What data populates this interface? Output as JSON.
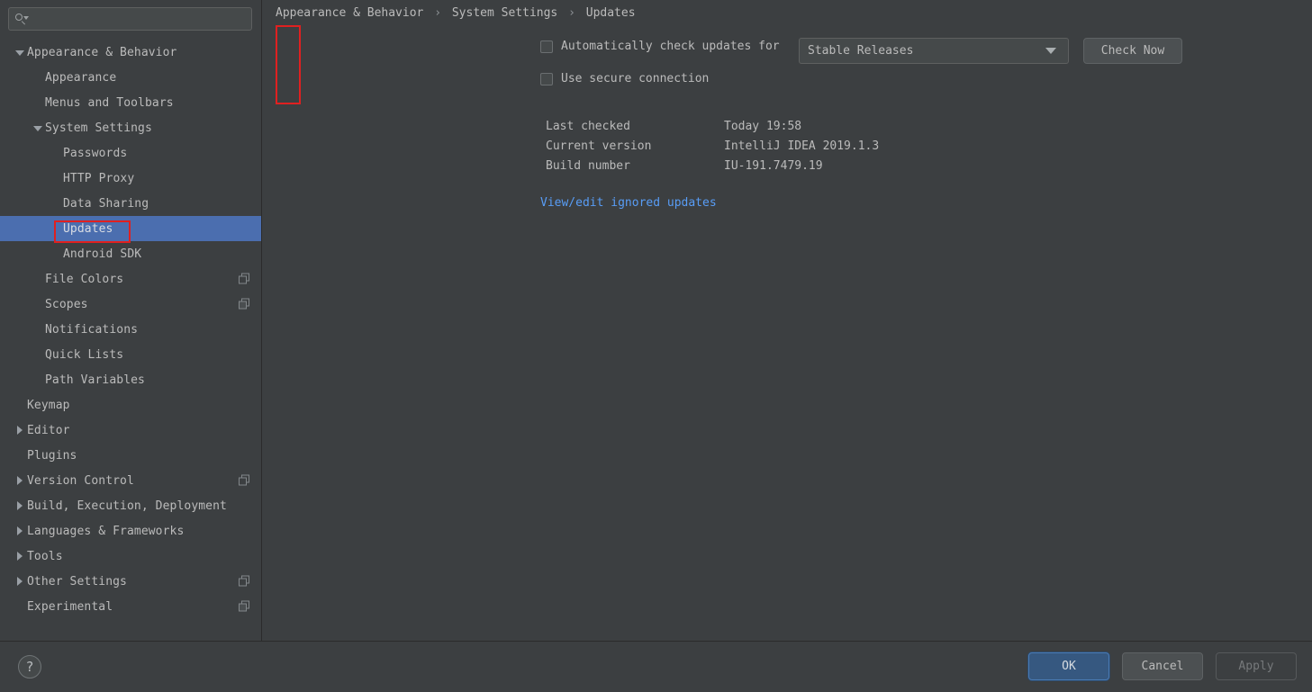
{
  "search": {
    "placeholder": "",
    "value": "",
    "icon": "search-icon"
  },
  "sidebar": {
    "items": [
      {
        "label": "Appearance & Behavior",
        "level": 0,
        "twisty": "down",
        "selected": false,
        "copy_icon": "none"
      },
      {
        "label": "Appearance",
        "level": 1,
        "twisty": "none",
        "selected": false,
        "copy_icon": "none"
      },
      {
        "label": "Menus and Toolbars",
        "level": 1,
        "twisty": "none",
        "selected": false,
        "copy_icon": "none"
      },
      {
        "label": "System Settings",
        "level": 1,
        "twisty": "down",
        "selected": false,
        "copy_icon": "none"
      },
      {
        "label": "Passwords",
        "level": 2,
        "twisty": "none",
        "selected": false,
        "copy_icon": "none"
      },
      {
        "label": "HTTP Proxy",
        "level": 2,
        "twisty": "none",
        "selected": false,
        "copy_icon": "none"
      },
      {
        "label": "Data Sharing",
        "level": 2,
        "twisty": "none",
        "selected": false,
        "copy_icon": "none"
      },
      {
        "label": "Updates",
        "level": 2,
        "twisty": "none",
        "selected": true,
        "copy_icon": "none"
      },
      {
        "label": "Android SDK",
        "level": 2,
        "twisty": "none",
        "selected": false,
        "copy_icon": "none"
      },
      {
        "label": "File Colors",
        "level": 1,
        "twisty": "none",
        "selected": false,
        "copy_icon": "copy-icon"
      },
      {
        "label": "Scopes",
        "level": 1,
        "twisty": "none",
        "selected": false,
        "copy_icon": "copy-icon-filled"
      },
      {
        "label": "Notifications",
        "level": 1,
        "twisty": "none",
        "selected": false,
        "copy_icon": "none"
      },
      {
        "label": "Quick Lists",
        "level": 1,
        "twisty": "none",
        "selected": false,
        "copy_icon": "none"
      },
      {
        "label": "Path Variables",
        "level": 1,
        "twisty": "none",
        "selected": false,
        "copy_icon": "none"
      },
      {
        "label": "Keymap",
        "level": 0,
        "twisty": "none",
        "selected": false,
        "copy_icon": "none"
      },
      {
        "label": "Editor",
        "level": 0,
        "twisty": "right",
        "selected": false,
        "copy_icon": "none"
      },
      {
        "label": "Plugins",
        "level": 0,
        "twisty": "none",
        "selected": false,
        "copy_icon": "none"
      },
      {
        "label": "Version Control",
        "level": 0,
        "twisty": "right",
        "selected": false,
        "copy_icon": "copy-icon"
      },
      {
        "label": "Build, Execution, Deployment",
        "level": 0,
        "twisty": "right",
        "selected": false,
        "copy_icon": "none"
      },
      {
        "label": "Languages & Frameworks",
        "level": 0,
        "twisty": "right",
        "selected": false,
        "copy_icon": "none"
      },
      {
        "label": "Tools",
        "level": 0,
        "twisty": "right",
        "selected": false,
        "copy_icon": "none"
      },
      {
        "label": "Other Settings",
        "level": 0,
        "twisty": "right",
        "selected": false,
        "copy_icon": "copy-icon"
      },
      {
        "label": "Experimental",
        "level": 0,
        "twisty": "none",
        "selected": false,
        "copy_icon": "copy-icon-filled"
      }
    ]
  },
  "breadcrumb": {
    "crumb1": "Appearance & Behavior",
    "sep1": "›",
    "crumb2": "System Settings",
    "sep2": "›",
    "crumb3": "Updates"
  },
  "main": {
    "auto_check_label": "Automatically check updates for",
    "auto_check_checked": false,
    "secure_connection_label": "Use secure connection",
    "secure_connection_checked": false,
    "channel_value": "Stable Releases",
    "check_now_label": "Check Now",
    "info_rows": [
      {
        "key": "Last checked",
        "value": "Today 19:58"
      },
      {
        "key": "Current version",
        "value": "IntelliJ IDEA 2019.1.3"
      },
      {
        "key": "Build number",
        "value": "IU-191.7479.19"
      }
    ],
    "ignored_updates_link": "View/edit ignored updates"
  },
  "footer": {
    "help_label": "?",
    "ok_label": "OK",
    "cancel_label": "Cancel",
    "apply_label": "Apply"
  },
  "colors": {
    "background": "#3c3f41",
    "selection": "#4b6eaf",
    "link": "#589df6",
    "primary_button": "#365880",
    "annotation": "#e02020",
    "text": "#bbbbbb"
  }
}
